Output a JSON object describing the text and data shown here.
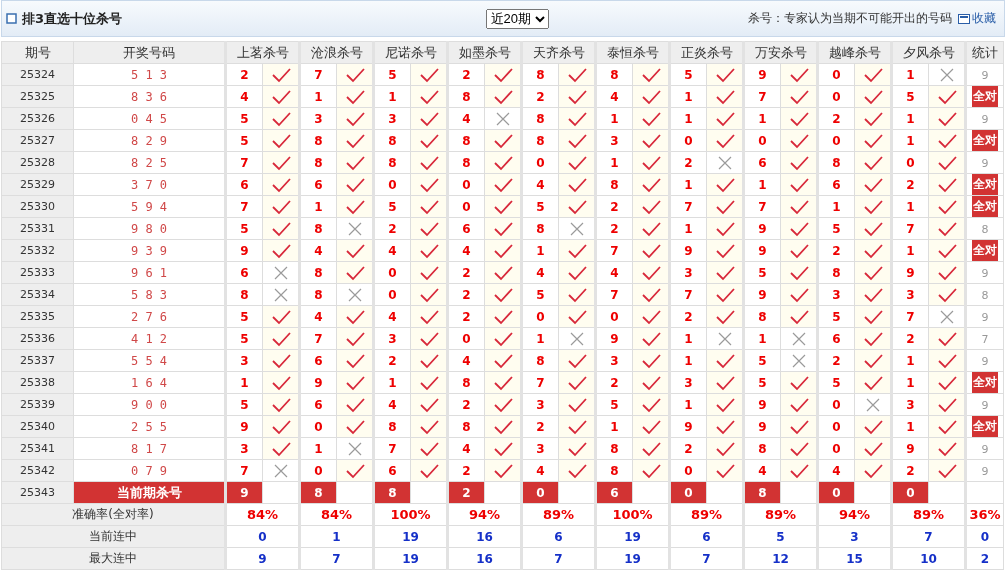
{
  "header": {
    "title": "排3直选十位杀号",
    "period_select": "近20期",
    "note": "杀号：专家认为当期不可能开出的号码",
    "favorite_link": "收藏"
  },
  "table": {
    "columns": {
      "period": "期号",
      "draw": "开奖号码",
      "experts": [
        "上茗杀号",
        "沧浪杀号",
        "尼诺杀号",
        "如墨杀号",
        "天齐杀号",
        "泰恒杀号",
        "正炎杀号",
        "万安杀号",
        "越峰杀号",
        "夕风杀号"
      ],
      "stat": "统计"
    },
    "rows": [
      {
        "period": "25324",
        "draw": "5 1 3",
        "kills": [
          {
            "n": "2",
            "hit": true
          },
          {
            "n": "7",
            "hit": true
          },
          {
            "n": "5",
            "hit": true
          },
          {
            "n": "2",
            "hit": true
          },
          {
            "n": "8",
            "hit": true
          },
          {
            "n": "8",
            "hit": true
          },
          {
            "n": "5",
            "hit": true
          },
          {
            "n": "9",
            "hit": true
          },
          {
            "n": "0",
            "hit": true
          },
          {
            "n": "1",
            "hit": false
          }
        ],
        "stat": "9",
        "all_correct": false
      },
      {
        "period": "25325",
        "draw": "8 3 6",
        "kills": [
          {
            "n": "4",
            "hit": true
          },
          {
            "n": "1",
            "hit": true
          },
          {
            "n": "1",
            "hit": true
          },
          {
            "n": "8",
            "hit": true
          },
          {
            "n": "2",
            "hit": true
          },
          {
            "n": "4",
            "hit": true
          },
          {
            "n": "1",
            "hit": true
          },
          {
            "n": "7",
            "hit": true
          },
          {
            "n": "0",
            "hit": true
          },
          {
            "n": "5",
            "hit": true
          }
        ],
        "stat": "全对",
        "all_correct": true
      },
      {
        "period": "25326",
        "draw": "0 4 5",
        "kills": [
          {
            "n": "5",
            "hit": true
          },
          {
            "n": "3",
            "hit": true
          },
          {
            "n": "3",
            "hit": true
          },
          {
            "n": "4",
            "hit": false
          },
          {
            "n": "8",
            "hit": true
          },
          {
            "n": "1",
            "hit": true
          },
          {
            "n": "1",
            "hit": true
          },
          {
            "n": "1",
            "hit": true
          },
          {
            "n": "2",
            "hit": true
          },
          {
            "n": "1",
            "hit": true
          }
        ],
        "stat": "9",
        "all_correct": false
      },
      {
        "period": "25327",
        "draw": "8 2 9",
        "kills": [
          {
            "n": "5",
            "hit": true
          },
          {
            "n": "8",
            "hit": true
          },
          {
            "n": "8",
            "hit": true
          },
          {
            "n": "8",
            "hit": true
          },
          {
            "n": "8",
            "hit": true
          },
          {
            "n": "3",
            "hit": true
          },
          {
            "n": "0",
            "hit": true
          },
          {
            "n": "0",
            "hit": true
          },
          {
            "n": "0",
            "hit": true
          },
          {
            "n": "1",
            "hit": true
          }
        ],
        "stat": "全对",
        "all_correct": true
      },
      {
        "period": "25328",
        "draw": "8 2 5",
        "kills": [
          {
            "n": "7",
            "hit": true
          },
          {
            "n": "8",
            "hit": true
          },
          {
            "n": "8",
            "hit": true
          },
          {
            "n": "8",
            "hit": true
          },
          {
            "n": "0",
            "hit": true
          },
          {
            "n": "1",
            "hit": true
          },
          {
            "n": "2",
            "hit": false
          },
          {
            "n": "6",
            "hit": true
          },
          {
            "n": "8",
            "hit": true
          },
          {
            "n": "0",
            "hit": true
          }
        ],
        "stat": "9",
        "all_correct": false
      },
      {
        "period": "25329",
        "draw": "3 7 0",
        "kills": [
          {
            "n": "6",
            "hit": true
          },
          {
            "n": "6",
            "hit": true
          },
          {
            "n": "0",
            "hit": true
          },
          {
            "n": "0",
            "hit": true
          },
          {
            "n": "4",
            "hit": true
          },
          {
            "n": "8",
            "hit": true
          },
          {
            "n": "1",
            "hit": true
          },
          {
            "n": "1",
            "hit": true
          },
          {
            "n": "6",
            "hit": true
          },
          {
            "n": "2",
            "hit": true
          }
        ],
        "stat": "全对",
        "all_correct": true
      },
      {
        "period": "25330",
        "draw": "5 9 4",
        "kills": [
          {
            "n": "7",
            "hit": true
          },
          {
            "n": "1",
            "hit": true
          },
          {
            "n": "5",
            "hit": true
          },
          {
            "n": "0",
            "hit": true
          },
          {
            "n": "5",
            "hit": true
          },
          {
            "n": "2",
            "hit": true
          },
          {
            "n": "7",
            "hit": true
          },
          {
            "n": "7",
            "hit": true
          },
          {
            "n": "1",
            "hit": true
          },
          {
            "n": "1",
            "hit": true
          }
        ],
        "stat": "全对",
        "all_correct": true
      },
      {
        "period": "25331",
        "draw": "9 8 0",
        "kills": [
          {
            "n": "5",
            "hit": true
          },
          {
            "n": "8",
            "hit": false
          },
          {
            "n": "2",
            "hit": true
          },
          {
            "n": "6",
            "hit": true
          },
          {
            "n": "8",
            "hit": false
          },
          {
            "n": "2",
            "hit": true
          },
          {
            "n": "1",
            "hit": true
          },
          {
            "n": "9",
            "hit": true
          },
          {
            "n": "5",
            "hit": true
          },
          {
            "n": "7",
            "hit": true
          }
        ],
        "stat": "8",
        "all_correct": false
      },
      {
        "period": "25332",
        "draw": "9 3 9",
        "kills": [
          {
            "n": "9",
            "hit": true
          },
          {
            "n": "4",
            "hit": true
          },
          {
            "n": "4",
            "hit": true
          },
          {
            "n": "4",
            "hit": true
          },
          {
            "n": "1",
            "hit": true
          },
          {
            "n": "7",
            "hit": true
          },
          {
            "n": "9",
            "hit": true
          },
          {
            "n": "9",
            "hit": true
          },
          {
            "n": "2",
            "hit": true
          },
          {
            "n": "1",
            "hit": true
          }
        ],
        "stat": "全对",
        "all_correct": true
      },
      {
        "period": "25333",
        "draw": "9 6 1",
        "kills": [
          {
            "n": "6",
            "hit": false
          },
          {
            "n": "8",
            "hit": true
          },
          {
            "n": "0",
            "hit": true
          },
          {
            "n": "2",
            "hit": true
          },
          {
            "n": "4",
            "hit": true
          },
          {
            "n": "4",
            "hit": true
          },
          {
            "n": "3",
            "hit": true
          },
          {
            "n": "5",
            "hit": true
          },
          {
            "n": "8",
            "hit": true
          },
          {
            "n": "9",
            "hit": true
          }
        ],
        "stat": "9",
        "all_correct": false
      },
      {
        "period": "25334",
        "draw": "5 8 3",
        "kills": [
          {
            "n": "8",
            "hit": false
          },
          {
            "n": "8",
            "hit": false
          },
          {
            "n": "0",
            "hit": true
          },
          {
            "n": "2",
            "hit": true
          },
          {
            "n": "5",
            "hit": true
          },
          {
            "n": "7",
            "hit": true
          },
          {
            "n": "7",
            "hit": true
          },
          {
            "n": "9",
            "hit": true
          },
          {
            "n": "3",
            "hit": true
          },
          {
            "n": "3",
            "hit": true
          }
        ],
        "stat": "8",
        "all_correct": false
      },
      {
        "period": "25335",
        "draw": "2 7 6",
        "kills": [
          {
            "n": "5",
            "hit": true
          },
          {
            "n": "4",
            "hit": true
          },
          {
            "n": "4",
            "hit": true
          },
          {
            "n": "2",
            "hit": true
          },
          {
            "n": "0",
            "hit": true
          },
          {
            "n": "0",
            "hit": true
          },
          {
            "n": "2",
            "hit": true
          },
          {
            "n": "8",
            "hit": true
          },
          {
            "n": "5",
            "hit": true
          },
          {
            "n": "7",
            "hit": false
          }
        ],
        "stat": "9",
        "all_correct": false
      },
      {
        "period": "25336",
        "draw": "4 1 2",
        "kills": [
          {
            "n": "5",
            "hit": true
          },
          {
            "n": "7",
            "hit": true
          },
          {
            "n": "3",
            "hit": true
          },
          {
            "n": "0",
            "hit": true
          },
          {
            "n": "1",
            "hit": false
          },
          {
            "n": "9",
            "hit": true
          },
          {
            "n": "1",
            "hit": false
          },
          {
            "n": "1",
            "hit": false
          },
          {
            "n": "6",
            "hit": true
          },
          {
            "n": "2",
            "hit": true
          }
        ],
        "stat": "7",
        "all_correct": false
      },
      {
        "period": "25337",
        "draw": "5 5 4",
        "kills": [
          {
            "n": "3",
            "hit": true
          },
          {
            "n": "6",
            "hit": true
          },
          {
            "n": "2",
            "hit": true
          },
          {
            "n": "4",
            "hit": true
          },
          {
            "n": "8",
            "hit": true
          },
          {
            "n": "3",
            "hit": true
          },
          {
            "n": "1",
            "hit": true
          },
          {
            "n": "5",
            "hit": false
          },
          {
            "n": "2",
            "hit": true
          },
          {
            "n": "1",
            "hit": true
          }
        ],
        "stat": "9",
        "all_correct": false
      },
      {
        "period": "25338",
        "draw": "1 6 4",
        "kills": [
          {
            "n": "1",
            "hit": true
          },
          {
            "n": "9",
            "hit": true
          },
          {
            "n": "1",
            "hit": true
          },
          {
            "n": "8",
            "hit": true
          },
          {
            "n": "7",
            "hit": true
          },
          {
            "n": "2",
            "hit": true
          },
          {
            "n": "3",
            "hit": true
          },
          {
            "n": "5",
            "hit": true
          },
          {
            "n": "5",
            "hit": true
          },
          {
            "n": "1",
            "hit": true
          }
        ],
        "stat": "全对",
        "all_correct": true
      },
      {
        "period": "25339",
        "draw": "9 0 0",
        "kills": [
          {
            "n": "5",
            "hit": true
          },
          {
            "n": "6",
            "hit": true
          },
          {
            "n": "4",
            "hit": true
          },
          {
            "n": "2",
            "hit": true
          },
          {
            "n": "3",
            "hit": true
          },
          {
            "n": "5",
            "hit": true
          },
          {
            "n": "1",
            "hit": true
          },
          {
            "n": "9",
            "hit": true
          },
          {
            "n": "0",
            "hit": false
          },
          {
            "n": "3",
            "hit": true
          }
        ],
        "stat": "9",
        "all_correct": false
      },
      {
        "period": "25340",
        "draw": "2 5 5",
        "kills": [
          {
            "n": "9",
            "hit": true
          },
          {
            "n": "0",
            "hit": true
          },
          {
            "n": "8",
            "hit": true
          },
          {
            "n": "8",
            "hit": true
          },
          {
            "n": "2",
            "hit": true
          },
          {
            "n": "1",
            "hit": true
          },
          {
            "n": "9",
            "hit": true
          },
          {
            "n": "9",
            "hit": true
          },
          {
            "n": "0",
            "hit": true
          },
          {
            "n": "1",
            "hit": true
          }
        ],
        "stat": "全对",
        "all_correct": true
      },
      {
        "period": "25341",
        "draw": "8 1 7",
        "kills": [
          {
            "n": "3",
            "hit": true
          },
          {
            "n": "1",
            "hit": false
          },
          {
            "n": "7",
            "hit": true
          },
          {
            "n": "4",
            "hit": true
          },
          {
            "n": "3",
            "hit": true
          },
          {
            "n": "8",
            "hit": true
          },
          {
            "n": "2",
            "hit": true
          },
          {
            "n": "8",
            "hit": true
          },
          {
            "n": "0",
            "hit": true
          },
          {
            "n": "9",
            "hit": true
          }
        ],
        "stat": "9",
        "all_correct": false
      },
      {
        "period": "25342",
        "draw": "0 7 9",
        "kills": [
          {
            "n": "7",
            "hit": false
          },
          {
            "n": "0",
            "hit": true
          },
          {
            "n": "6",
            "hit": true
          },
          {
            "n": "2",
            "hit": true
          },
          {
            "n": "4",
            "hit": true
          },
          {
            "n": "8",
            "hit": true
          },
          {
            "n": "0",
            "hit": true
          },
          {
            "n": "4",
            "hit": true
          },
          {
            "n": "4",
            "hit": true
          },
          {
            "n": "2",
            "hit": true
          }
        ],
        "stat": "9",
        "all_correct": false
      }
    ],
    "current": {
      "period": "25343",
      "label": "当前期杀号",
      "kills": [
        "9",
        "8",
        "8",
        "2",
        "0",
        "6",
        "0",
        "8",
        "0",
        "0"
      ]
    },
    "summary": [
      {
        "label": "准确率(全对率)",
        "kind": "rate",
        "values": [
          "84%",
          "84%",
          "100%",
          "94%",
          "89%",
          "100%",
          "89%",
          "89%",
          "94%",
          "89%"
        ],
        "stat": "36%"
      },
      {
        "label": "当前连中",
        "kind": "streak",
        "values": [
          "0",
          "1",
          "19",
          "16",
          "6",
          "19",
          "6",
          "5",
          "3",
          "7"
        ],
        "stat": "0"
      },
      {
        "label": "最大连中",
        "kind": "streak",
        "values": [
          "9",
          "7",
          "19",
          "16",
          "7",
          "19",
          "7",
          "12",
          "15",
          "10"
        ],
        "stat": "2"
      }
    ]
  }
}
